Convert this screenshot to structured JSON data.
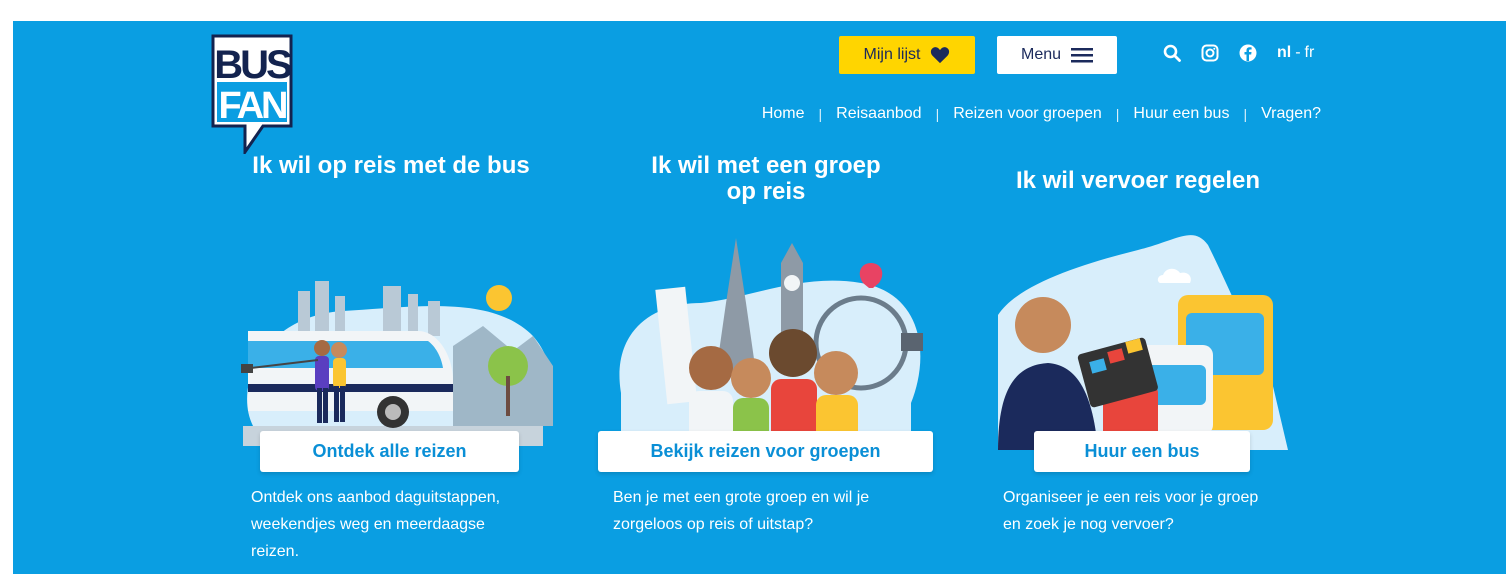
{
  "header": {
    "logo_top": "BUS",
    "logo_bottom": "FAN",
    "my_list_label": "Mijn lijst",
    "menu_label": "Menu",
    "icons": [
      "search-icon",
      "instagram-icon",
      "facebook-icon"
    ],
    "lang_active": "nl",
    "lang_sep": "-",
    "lang_other": "fr"
  },
  "nav": {
    "items": [
      "Home",
      "Reisaanbod",
      "Reizen voor groepen",
      "Huur een bus",
      "Vragen?"
    ],
    "separator": "|"
  },
  "columns": [
    {
      "title": "Ik wil op reis met de bus",
      "cta": "Ontdek alle reizen",
      "description": "Ontdek ons aanbod daguitstappen, weekendjes weg en meerdaagse reizen."
    },
    {
      "title": "Ik wil met een groep op reis",
      "cta": "Bekijk reizen voor groepen",
      "description": "Ben je met een grote groep en wil je zorgeloos op reis of uitstap?"
    },
    {
      "title": "Ik wil vervoer regelen",
      "cta": "Huur een bus",
      "description": "Organiseer je een reis voor je groep en zoek je nog vervoer?"
    }
  ],
  "colors": {
    "background": "#0a9ee2",
    "accent_yellow": "#ffd500",
    "navy": "#1b2a5c",
    "cta_text": "#0a8fd6"
  }
}
